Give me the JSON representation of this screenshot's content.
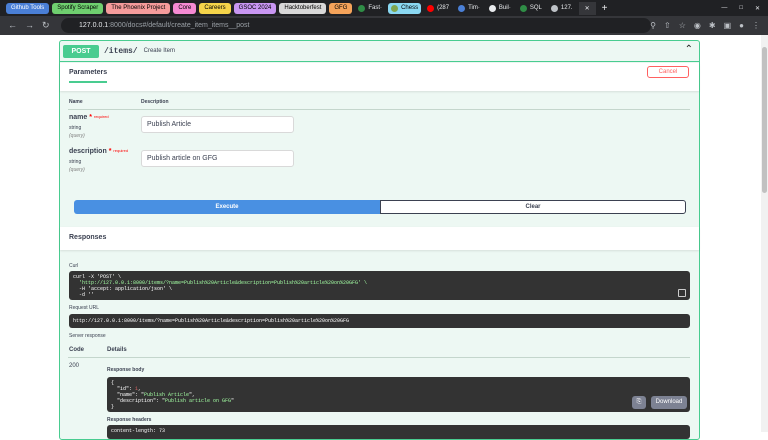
{
  "bookmarks": [
    {
      "label": "Github Tools",
      "color": "#4a7fd6"
    },
    {
      "label": "Spotify Scraper",
      "color": "#6fcf6f"
    },
    {
      "label": "The Phoenix Project",
      "color": "#f59b9b"
    },
    {
      "label": "Core",
      "color": "#f58ad3"
    },
    {
      "label": "Careers",
      "color": "#f5d44a"
    },
    {
      "label": "GSOC 2024",
      "color": "#c896f2"
    },
    {
      "label": "Hacktoberfest",
      "color": "#d8d8d8"
    },
    {
      "label": "GFG",
      "color": "#f5a35a"
    }
  ],
  "tabs": [
    {
      "label": "Fast·",
      "icon": "gfg-icon"
    },
    {
      "label": "Chess",
      "icon": "chess-icon"
    },
    {
      "label": "(287",
      "icon": "youtube-icon"
    },
    {
      "label": "Tim·",
      "icon": "doc-icon"
    },
    {
      "label": "Buil·",
      "icon": "github-icon"
    },
    {
      "label": "SQL",
      "icon": "gfg-icon"
    },
    {
      "label": "127.",
      "icon": "globe-icon"
    }
  ],
  "address": {
    "host": "127.0.0.1",
    "rest": ":8000/docs#/default/create_item_items__post"
  },
  "operation": {
    "method": "POST",
    "path": "/items/",
    "summary": "Create Item"
  },
  "parameters": {
    "title": "Parameters",
    "cancel": "Cancel",
    "col_name": "Name",
    "col_desc": "Description",
    "required_label": "required",
    "items": [
      {
        "name": "name",
        "type": "string",
        "in": "(query)",
        "value": "Publish Article"
      },
      {
        "name": "description",
        "type": "string",
        "in": "(query)",
        "value": "Publish article on GFG"
      }
    ]
  },
  "buttons": {
    "execute": "Execute",
    "clear": "Clear"
  },
  "responses": {
    "title": "Responses",
    "curl_label": "Curl",
    "curl_lines": [
      "curl -X 'POST' \\",
      "  'http://127.0.0.1:8000/items/?name=Publish%20Article&description=Publish%20article%20on%20GFG' \\",
      "  -H 'accept: application/json' \\",
      "  -d ''"
    ],
    "request_url_label": "Request URL",
    "request_url": "http://127.0.0.1:8000/items/?name=Publish%20Article&description=Publish%20article%20on%20GFG",
    "server_response_label": "Server response",
    "code_label": "Code",
    "details_label": "Details",
    "code": "200",
    "body_label": "Response body",
    "body": {
      "id": 1,
      "name": "Publish Article",
      "description": "Publish article on GFG"
    },
    "download": "Download",
    "headers_label": "Response headers",
    "headers_preview": "content-length: 73"
  }
}
